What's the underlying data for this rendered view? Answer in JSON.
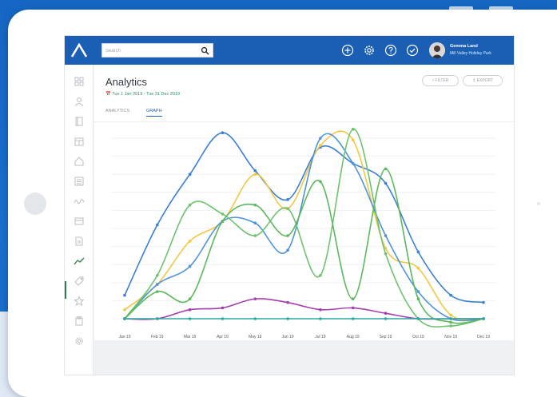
{
  "search": {
    "placeholder": "Search"
  },
  "user": {
    "name": "Gemma Land",
    "org": "Mill Valley Holiday Park"
  },
  "page": {
    "title": "Analytics",
    "date_range": "Tue 1 Jan 2019 - Tue 31 Dec 2019",
    "filter_label": "FILTER",
    "export_label": "EXPORT"
  },
  "tabs": [
    {
      "label": "ANALYTICS",
      "active": false
    },
    {
      "label": "GRAPH",
      "active": true
    }
  ],
  "topbar_icons": [
    "plus-circle-icon",
    "gear-icon",
    "help-circle-icon",
    "check-circle-icon"
  ],
  "sidebar_icons": [
    "dashboard-icon",
    "people-icon",
    "book-icon",
    "calendar-icon",
    "home-icon",
    "list-icon",
    "link-icon",
    "card-icon",
    "document-icon",
    "chart-icon",
    "tag-icon",
    "star-icon",
    "clipboard-icon",
    "settings-icon"
  ],
  "colors": {
    "brand": "#1a5fb4",
    "active_sidebar": "#2e7d4f"
  },
  "chart_data": {
    "type": "line",
    "categories": [
      "Jan 19",
      "Feb 19",
      "Mar 19",
      "Apr 19",
      "May 19",
      "Jun 19",
      "Jul 19",
      "Aug 19",
      "Sep 19",
      "Oct 19",
      "Nov 19",
      "Dec 19"
    ],
    "ylim": [
      0,
      10
    ],
    "grid": true,
    "series": [
      {
        "color": "#3a7fd1",
        "values": [
          1.3,
          5.2,
          8.0,
          10.3,
          8.2,
          6.6,
          9.5,
          8.6,
          7.5,
          3.7,
          1.3,
          0.9
        ]
      },
      {
        "color": "#f3c744",
        "values": [
          0.5,
          1.9,
          4.3,
          5.4,
          8.0,
          6.1,
          9.6,
          9.9,
          3.9,
          2.8,
          0.2,
          0.0
        ]
      },
      {
        "color": "#4f93d8",
        "values": [
          0.0,
          1.9,
          2.9,
          5.4,
          5.3,
          3.8,
          10.0,
          8.6,
          4.6,
          1.5,
          0.0,
          0.0
        ]
      },
      {
        "color": "#6dc36d",
        "values": [
          0.0,
          2.4,
          6.3,
          5.8,
          4.6,
          6.1,
          2.4,
          10.5,
          3.6,
          0.0,
          -0.4,
          0.0
        ]
      },
      {
        "color": "#5bb85b",
        "values": [
          0.0,
          1.5,
          1.1,
          5.4,
          6.3,
          4.6,
          7.6,
          1.1,
          8.3,
          1.1,
          -0.2,
          0.0
        ]
      },
      {
        "color": "#a43fae",
        "values": [
          0.0,
          0.0,
          0.5,
          0.6,
          1.1,
          0.9,
          0.5,
          0.6,
          0.3,
          0.0,
          0.0,
          0.0
        ]
      },
      {
        "color": "#2ca9a1",
        "values": [
          0.0,
          0.0,
          0.0,
          0.0,
          0.0,
          0.0,
          0.0,
          0.0,
          0.0,
          0.0,
          0.0,
          0.0
        ]
      }
    ]
  }
}
